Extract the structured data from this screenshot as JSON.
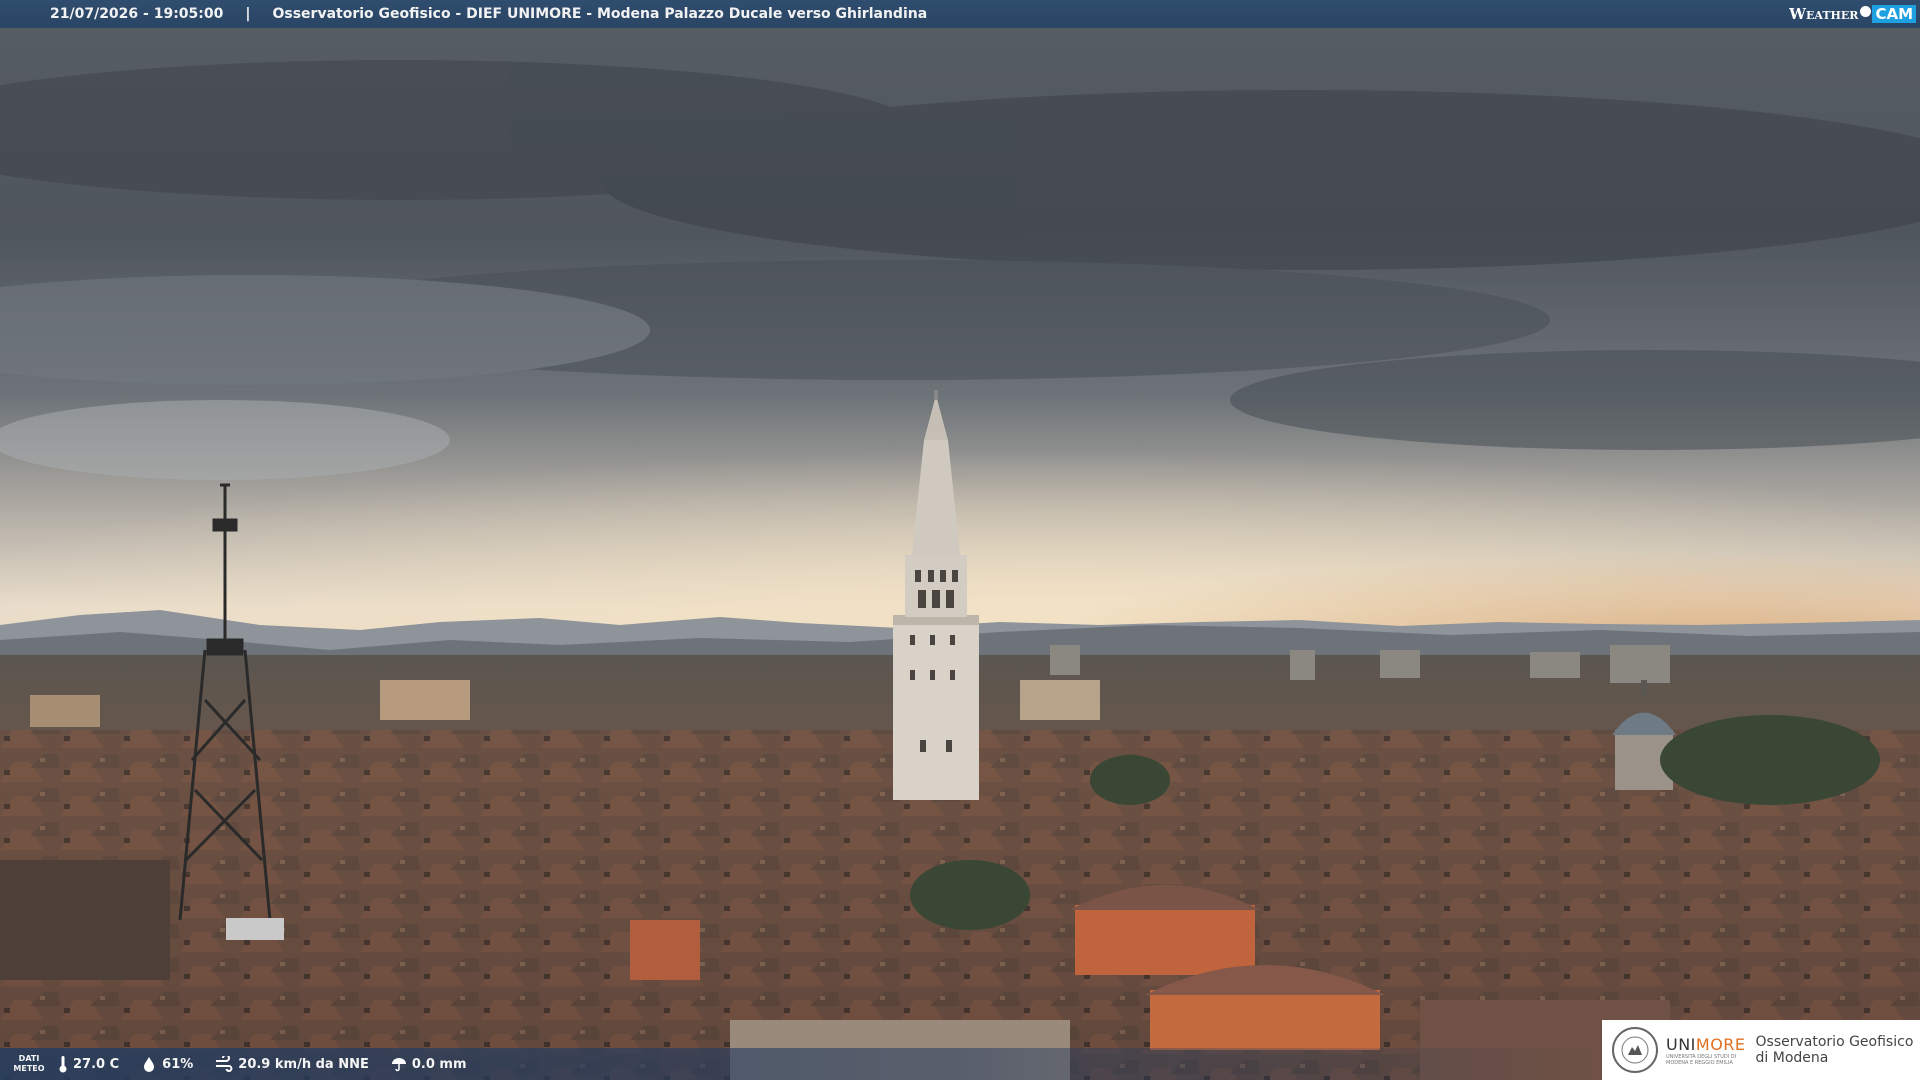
{
  "header": {
    "timestamp": "21/07/2026 - 19:05:00",
    "separator": "|",
    "title": "Osservatorio Geofisico - DIEF UNIMORE - Modena Palazzo Ducale verso Ghirlandina"
  },
  "brand": {
    "weather": "Weather",
    "cam": "CAM"
  },
  "meteo": {
    "label_line1": "DATI",
    "label_line2": "METEO",
    "temperature": "27.0 C",
    "humidity": "61%",
    "wind": "20.9 km/h da NNE",
    "rain": "0.0 mm"
  },
  "logo": {
    "uni_prefix": "UNI",
    "uni_suffix": "MORE",
    "uni_sub1": "UNIVERSITÀ DEGLI STUDI DI",
    "uni_sub2": "MODENA E REGGIO EMILIA",
    "obs_line1": "Osservatorio Geofisico",
    "obs_line2": "di Modena"
  },
  "colors": {
    "header_bg": "#2f4d6e",
    "cam_badge": "#1da1e0",
    "unimore_accent": "#e07020"
  }
}
